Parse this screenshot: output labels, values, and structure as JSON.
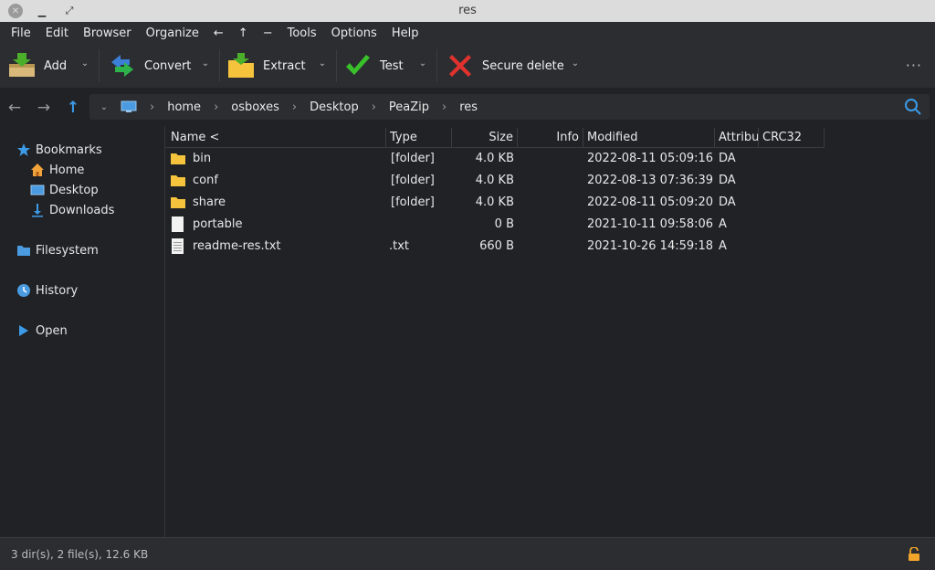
{
  "window": {
    "title": "res"
  },
  "menu": [
    "File",
    "Edit",
    "Browser",
    "Organize",
    "←",
    "↑",
    "−",
    "Tools",
    "Options",
    "Help"
  ],
  "toolbar": {
    "add": "Add",
    "convert": "Convert",
    "extract": "Extract",
    "test": "Test",
    "secure_delete": "Secure delete",
    "more": "···"
  },
  "address": {
    "segments": [
      "home",
      "osboxes",
      "Desktop",
      "PeaZip",
      "res"
    ]
  },
  "sidebar": {
    "bookmarks": "Bookmarks",
    "home": "Home",
    "desktop": "Desktop",
    "downloads": "Downloads",
    "filesystem": "Filesystem",
    "history": "History",
    "open": "Open"
  },
  "columns": [
    "Name <",
    "Type",
    "Size",
    "Info",
    "Modified",
    "Attribu",
    "CRC32"
  ],
  "files": [
    {
      "name": "bin",
      "type": "[folder]",
      "size": "4.0 KB",
      "info": "",
      "modified": "2022-08-11 05:09:16",
      "attr": "DA",
      "kind": "folder"
    },
    {
      "name": "conf",
      "type": "[folder]",
      "size": "4.0 KB",
      "info": "",
      "modified": "2022-08-13 07:36:39",
      "attr": "DA",
      "kind": "folder"
    },
    {
      "name": "share",
      "type": "[folder]",
      "size": "4.0 KB",
      "info": "",
      "modified": "2022-08-11 05:09:20",
      "attr": "DA",
      "kind": "folder"
    },
    {
      "name": "portable",
      "type": "",
      "size": "0 B",
      "info": "",
      "modified": "2021-10-11 09:58:06",
      "attr": "A",
      "kind": "file"
    },
    {
      "name": "readme-res.txt",
      "type": ".txt",
      "size": "660 B",
      "info": "",
      "modified": "2021-10-26 14:59:18",
      "attr": "A",
      "kind": "txt"
    }
  ],
  "status": {
    "summary": "3 dir(s), 2 file(s), 12.6 KB"
  },
  "colors": {
    "accent": "#3c9be8",
    "folder": "#f5c43c",
    "background": "#202226",
    "panel": "#2b2d31"
  }
}
